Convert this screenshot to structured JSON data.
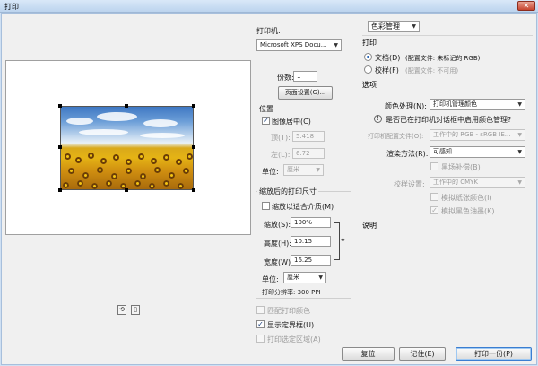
{
  "window": {
    "title": "打印",
    "close_glyph": "✕"
  },
  "preview": {
    "rotate_icon": "rotate-icon",
    "portrait_icon": "portrait-icon"
  },
  "printer": {
    "label": "打印机:",
    "selected": "Microsoft XPS Docu...",
    "copies_label": "份数:",
    "copies_value": "1",
    "page_setup_label": "页面设置(G)..."
  },
  "position": {
    "title": "位置",
    "center_label": "图像居中(C)",
    "center_checked": true,
    "top_label": "顶(T):",
    "top_value": "5.418",
    "left_label": "左(L):",
    "left_value": "6.72",
    "unit_label": "单位:",
    "unit_value": "厘米"
  },
  "scaled": {
    "title": "缩放后的打印尺寸",
    "fit_label": "缩放以适合介质(M)",
    "fit_checked": false,
    "scale_label": "缩放(S):",
    "scale_value": "100%",
    "height_label": "高度(H):",
    "height_value": "10.15",
    "width_label": "宽度(W):",
    "width_value": "16.25",
    "unit_label": "单位:",
    "unit_value": "厘米",
    "resolution": "打印分辨率: 300 PPI"
  },
  "bottom_options": {
    "match_colors": "匹配打印颜色",
    "show_bbox": "显示定界框(U)",
    "print_selection": "打印选定区域(A)"
  },
  "color_panel": {
    "mode": "色彩管理",
    "print_heading": "打印",
    "document_label": "文档(D)",
    "document_profile": "(配置文件: 未标记的 RGB)",
    "proof_label": "校样(F)",
    "proof_profile": "(配置文件: 不可用)",
    "options_heading": "选项",
    "color_handling_label": "颜色处理(N):",
    "color_handling_value": "打印机管理颜色",
    "notice_icon": "exclamation-icon",
    "notice_text": "是否已在打印机对话框中启用颜色管理?",
    "printer_profile_label": "打印机配置文件(O):",
    "printer_profile_value": "工作中的 RGB - sRGB IE...",
    "intent_label": "渲染方法(R):",
    "intent_value": "可感知",
    "bpc_label": "黑场补偿(B)",
    "proof_setup_label": "校样设置:",
    "proof_setup_value": "工作中的 CMYK",
    "simulate_paper_label": "模拟纸张颜色(I)",
    "simulate_black_label": "模拟黑色油墨(K)",
    "description_heading": "说明"
  },
  "buttons": {
    "done": "复位",
    "remember": "记住(E)",
    "print": "打印一份(P)"
  }
}
